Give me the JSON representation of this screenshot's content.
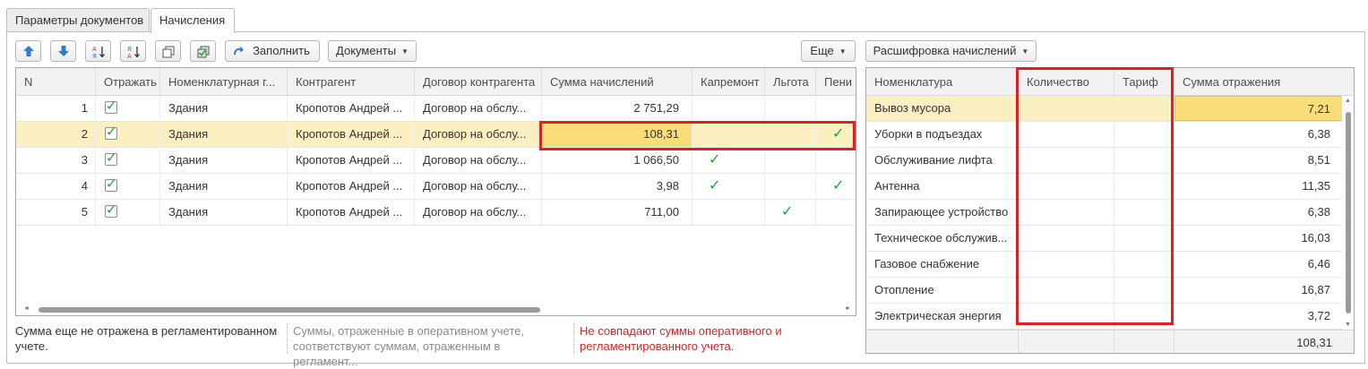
{
  "tabs": [
    {
      "label": "Параметры документов"
    },
    {
      "label": "Начисления"
    }
  ],
  "toolbar_left": {
    "fill_label": "Заполнить",
    "documents_label": "Документы",
    "more_label": "Еще"
  },
  "toolbar_right": {
    "breakdown_label": "Расшифровка начислений"
  },
  "left_table": {
    "columns": [
      "N",
      "Отражать",
      "Номенклатурная г...",
      "Контрагент",
      "Договор контрагента",
      "Сумма начислений",
      "Капремонт",
      "Льгота",
      "Пени"
    ],
    "rows": [
      {
        "n": "1",
        "reflect": true,
        "nomen": "Здания",
        "contractor": "Кропотов Андрей ...",
        "contract": "Договор на обслу...",
        "sum": "2 751,29",
        "kaprem": false,
        "lgota": false,
        "peni": false
      },
      {
        "n": "2",
        "reflect": true,
        "nomen": "Здания",
        "contractor": "Кропотов Андрей ...",
        "contract": "Договор на обслу...",
        "sum": "108,31",
        "kaprem": false,
        "lgota": false,
        "peni": true
      },
      {
        "n": "3",
        "reflect": true,
        "nomen": "Здания",
        "contractor": "Кропотов Андрей ...",
        "contract": "Договор на обслу...",
        "sum": "1 066,50",
        "kaprem": true,
        "lgota": false,
        "peni": false
      },
      {
        "n": "4",
        "reflect": true,
        "nomen": "Здания",
        "contractor": "Кропотов Андрей ...",
        "contract": "Договор на обслу...",
        "sum": "3,98",
        "kaprem": true,
        "lgota": false,
        "peni": true
      },
      {
        "n": "5",
        "reflect": true,
        "nomen": "Здания",
        "contractor": "Кропотов Андрей ...",
        "contract": "Договор на обслу...",
        "sum": "711,00",
        "kaprem": false,
        "lgota": true,
        "peni": false
      }
    ],
    "selected_row": 2
  },
  "right_table": {
    "columns": [
      "Номенклатура",
      "Количество",
      "Тариф",
      "Сумма отражения"
    ],
    "rows": [
      {
        "name": "Вывоз мусора",
        "qty": "",
        "tariff": "",
        "sum": "7,21"
      },
      {
        "name": "Уборки в подъездах",
        "qty": "",
        "tariff": "",
        "sum": "6,38"
      },
      {
        "name": "Обслуживание лифта",
        "qty": "",
        "tariff": "",
        "sum": "8,51"
      },
      {
        "name": "Антенна",
        "qty": "",
        "tariff": "",
        "sum": "11,35"
      },
      {
        "name": "Запирающее устройство",
        "qty": "",
        "tariff": "",
        "sum": "6,38"
      },
      {
        "name": "Техническое обслужив...",
        "qty": "",
        "tariff": "",
        "sum": "16,03"
      },
      {
        "name": "Газовое снабжение",
        "qty": "",
        "tariff": "",
        "sum": "6,46"
      },
      {
        "name": "Отопление",
        "qty": "",
        "tariff": "",
        "sum": "16,87"
      },
      {
        "name": "Электрическая энергия",
        "qty": "",
        "tariff": "",
        "sum": "3,72"
      }
    ],
    "total": "108,31"
  },
  "legend": {
    "not_reflected": "Сумма еще не отражена в регламентированном учете.",
    "matches": "Суммы, отраженные в оперативном учете, соответствуют суммам, отраженным в регламент...",
    "mismatch": "Не совпадают суммы оперативного и регламентированного учета."
  },
  "colors": {
    "highlight_box": "#e02020",
    "selected_row": "#fbf0c2",
    "selected_cell": "#f8dd7a",
    "check": "#22a03a",
    "mismatch_text": "#e02020",
    "muted_text": "#8a8a8a"
  },
  "icons": [
    "move-up-icon",
    "move-down-icon",
    "sort-ascending-icon",
    "sort-descending-icon",
    "copy-icon",
    "select-all-icon",
    "fill-arrow-icon"
  ]
}
